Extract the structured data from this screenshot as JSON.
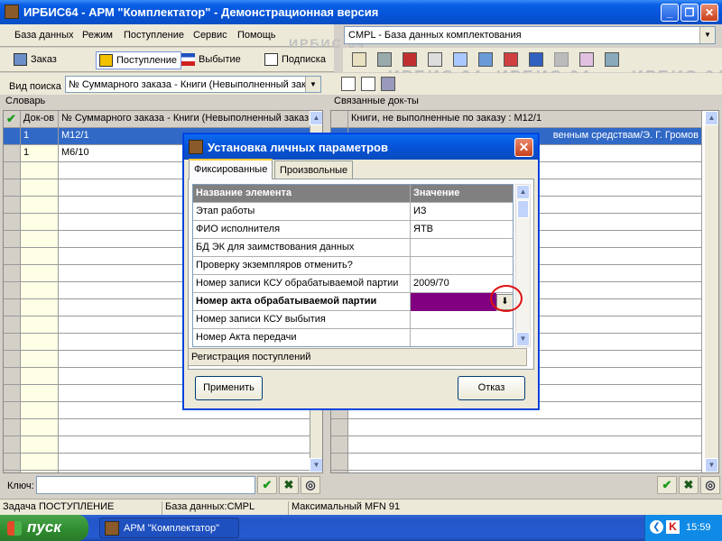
{
  "window": {
    "title": "ИРБИС64 - АРМ \"Комплектатор\" - Демонстрационная версия",
    "controls": {
      "minimize": "_",
      "restore": "❐",
      "close": "✕"
    }
  },
  "menu": [
    "База данных",
    "Режим",
    "Поступление",
    "Сервис",
    "Помощь"
  ],
  "database_select": {
    "value": "CMPL - База данных комплектования"
  },
  "toolbar": {
    "order_label": "Заказ",
    "receipt_label": "Поступление",
    "disposal_label": "Выбытие",
    "subscription_label": "Подписка"
  },
  "watermark": [
    "ИРБИС 64",
    "ИРБИС 64",
    "ИРБИС 64",
    "ИРБИС 64"
  ],
  "search": {
    "label": "Вид поиска",
    "value": "№ Суммарного заказа - Книги (Невыполненный зак"
  },
  "dictionary": {
    "header": "Словарь",
    "columns": [
      "Док-ов",
      "№ Суммарного заказа - Книги (Невыполненный заказ"
    ],
    "rows": [
      {
        "count": "1",
        "value": "M12/1"
      },
      {
        "count": "1",
        "value": "M6/10"
      }
    ]
  },
  "linked_docs": {
    "header": "Связанные док-ты",
    "column": "Книги, не выполненные по заказу                    : M12/1",
    "row1": "венным средствам/Э. Г. Громов"
  },
  "key": {
    "label": "Ключ:",
    "value": ""
  },
  "status": {
    "task": "Задача ПОСТУПЛЕНИЕ",
    "db": "База данных:CMPL",
    "mfn": "Максимальный MFN 91"
  },
  "taskbar": {
    "start": "пуск",
    "app": "АРМ \"Комплектатор\"",
    "time": "15:59"
  },
  "dialog": {
    "title": "Установка личных параметров",
    "tabs": [
      "Фиксированные",
      "Произвольные"
    ],
    "columns": [
      "Название элемента",
      "Значение"
    ],
    "rows": [
      {
        "name": "Этап работы",
        "value": "ИЗ"
      },
      {
        "name": "ФИО исполнителя",
        "value": "ЯТВ"
      },
      {
        "name": "БД ЭК для заимствования данных",
        "value": ""
      },
      {
        "name": "Проверку экземпляров отменить?",
        "value": ""
      },
      {
        "name": "Номер записи КСУ обрабатываемой партии",
        "value": "2009/70"
      },
      {
        "name": "Номер акта обрабатываемой партии",
        "value": ""
      },
      {
        "name": "Номер записи КСУ выбытия",
        "value": ""
      },
      {
        "name": "Номер Акта передачи",
        "value": ""
      }
    ],
    "section": "Регистрация поступлений",
    "apply_label": "Применить",
    "cancel_label": "Отказ"
  },
  "colors": {
    "selected_row": "#3169c6",
    "active_value": "#800080",
    "highlight_circle": "#e01010"
  }
}
